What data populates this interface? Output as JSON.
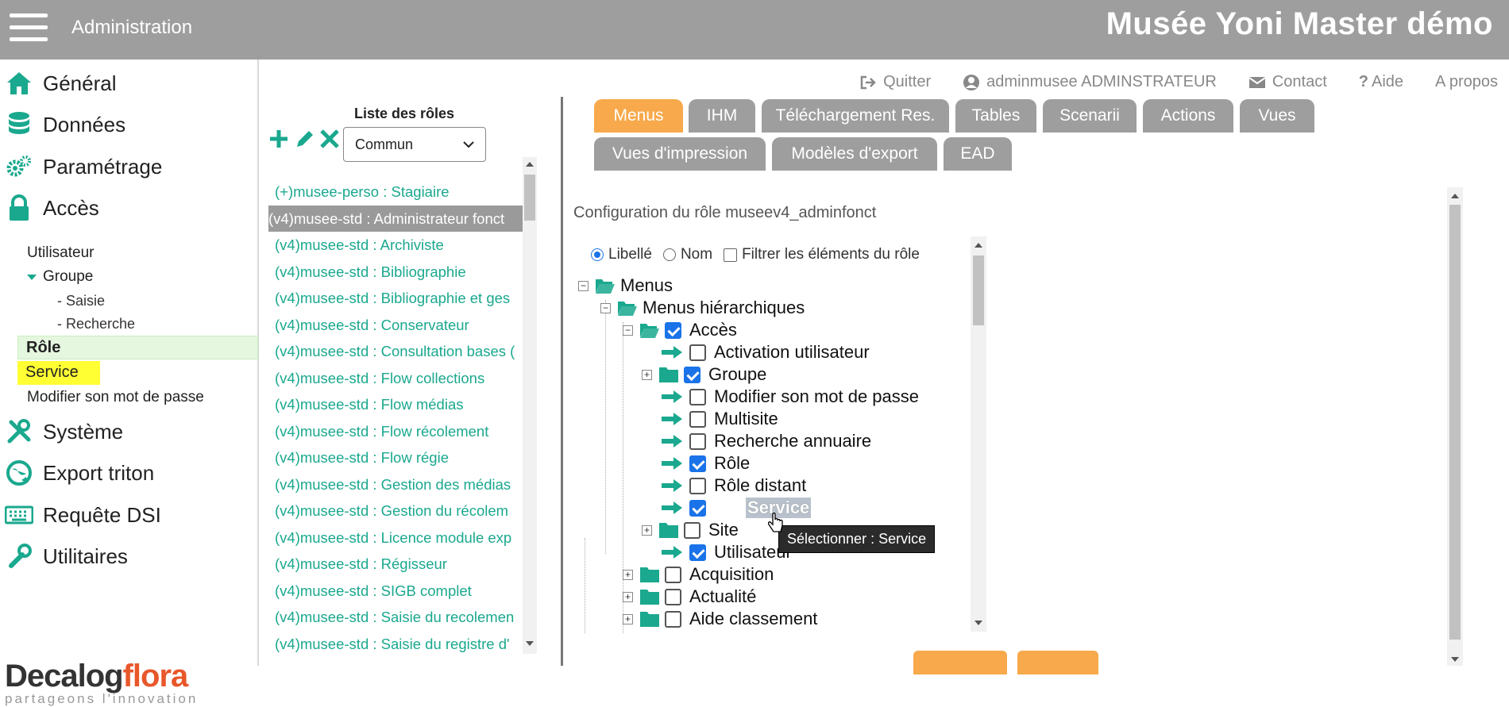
{
  "topbar": {
    "menu_label": "Administration",
    "app_title": "Musée Yoni Master démo"
  },
  "sidebar": {
    "nav": [
      {
        "label": "Général",
        "icon": "home-icon"
      },
      {
        "label": "Données",
        "icon": "database-icon"
      },
      {
        "label": "Paramétrage",
        "icon": "gears-icon"
      },
      {
        "label": "Accès",
        "icon": "lock-icon"
      },
      {
        "label": "Système",
        "icon": "tools-icon"
      },
      {
        "label": "Export triton",
        "icon": "globe-icon"
      },
      {
        "label": "Requête DSI",
        "icon": "keyboard-icon"
      },
      {
        "label": "Utilitaires",
        "icon": "wrench-icon"
      }
    ],
    "acces_sub": {
      "utilisateur": "Utilisateur",
      "groupe": "Groupe",
      "saisie": "- Saisie",
      "recherche": "- Recherche",
      "role": "Rôle",
      "service": "Service",
      "modifier": "Modifier son mot de passe"
    },
    "logo": {
      "part1": "Decalog",
      "part2": "flora",
      "tagline": "partageons l'innovation"
    },
    "colors": {
      "accent": "#1aa88e",
      "role_bg": "#e5f7df",
      "service_bg": "#ffff33"
    }
  },
  "header_links": {
    "quitter": "Quitter",
    "user": "adminmusee ADMINSTRATEUR",
    "contact": "Contact",
    "aide": "Aide",
    "apropos": "A propos"
  },
  "roles": {
    "title": "Liste des rôles",
    "select_value": "Commun",
    "items": [
      "(+)musee-perso : Stagiaire",
      "(v4)musee-std : Administrateur fonct",
      "(v4)musee-std : Archiviste",
      "(v4)musee-std : Bibliographie",
      "(v4)musee-std : Bibliographie et ges",
      "(v4)musee-std : Conservateur",
      "(v4)musee-std : Consultation bases (",
      "(v4)musee-std : Flow collections",
      "(v4)musee-std : Flow médias",
      "(v4)musee-std : Flow récolement",
      "(v4)musee-std : Flow régie",
      "(v4)musee-std : Gestion des médias",
      "(v4)musee-std : Gestion du récolem",
      "(v4)musee-std : Licence module exp",
      "(v4)musee-std : Régisseur",
      "(v4)musee-std : SIGB complet",
      "(v4)musee-std : Saisie du recolemen",
      "(v4)musee-std : Saisie du registre d'"
    ]
  },
  "tabs": {
    "row1": [
      "Menus",
      "IHM",
      "Téléchargement Res.",
      "Tables",
      "Scenarii",
      "Actions",
      "Vues"
    ],
    "row2": [
      "Vues d'impression",
      "Modèles d'export",
      "EAD"
    ],
    "active_color": "#f7a94b"
  },
  "config": {
    "label": "Configuration du rôle museev4_adminfonct",
    "filter_libelle": "Libellé",
    "filter_nom": "Nom",
    "filter_role": "Filtrer les éléments du rôle"
  },
  "tree": {
    "menus": "Menus",
    "menus_hier": "Menus hiérarchiques",
    "acces": "Accès",
    "children": [
      {
        "label": "Activation utilisateur",
        "checked": false
      },
      {
        "label": "Groupe",
        "checked": true
      },
      {
        "label": "Modifier son mot de passe",
        "checked": false
      },
      {
        "label": "Multisite",
        "checked": false
      },
      {
        "label": "Recherche annuaire",
        "checked": false
      },
      {
        "label": "Rôle",
        "checked": true
      },
      {
        "label": "Rôle distant",
        "checked": false
      },
      {
        "label": "Service",
        "checked": true
      },
      {
        "label": "Site",
        "checked": false
      },
      {
        "label": "Utilisateur",
        "checked": true
      }
    ],
    "siblings": [
      "Acquisition",
      "Actualité",
      "Aide classement"
    ]
  },
  "tooltip": "Sélectionner : Service"
}
